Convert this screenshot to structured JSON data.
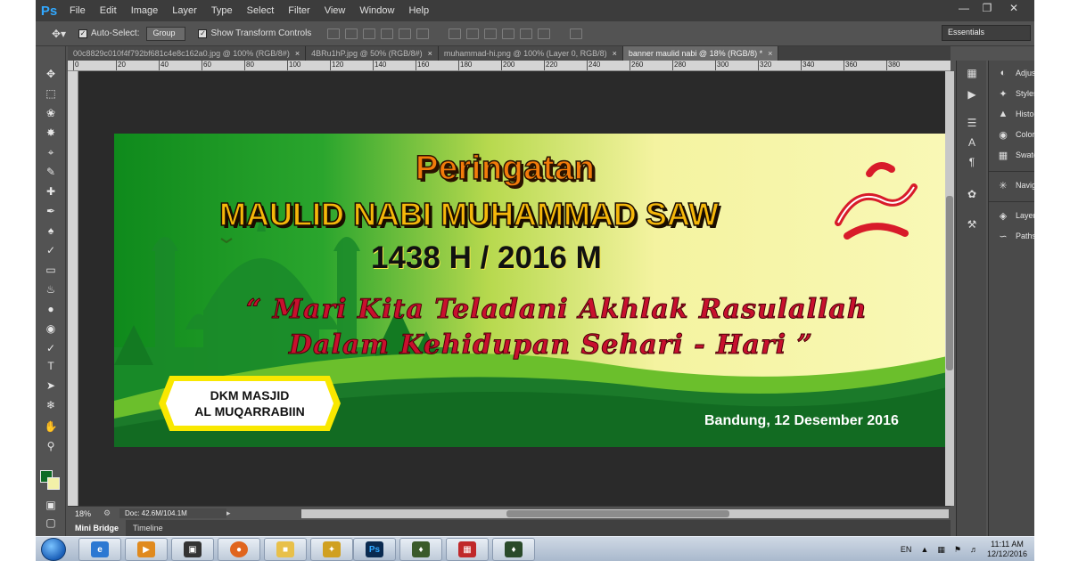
{
  "app": {
    "logo": "Ps",
    "menu": [
      "File",
      "Edit",
      "Image",
      "Layer",
      "Type",
      "Select",
      "Filter",
      "View",
      "Window",
      "Help"
    ],
    "window_buttons": [
      "minimize-icon",
      "restore-icon",
      "close-icon"
    ]
  },
  "options_bar": {
    "auto_select_label": "Auto-Select:",
    "auto_select_value": "Group",
    "show_transform_label": "Show Transform Controls",
    "workspace": "Essentials"
  },
  "tabs": [
    {
      "label": "00c8829c010f4f792bf681c4e8c162a0.jpg @ 100% (RGB/8#)",
      "active": false
    },
    {
      "label": "4BRu1hP.jpg @ 50% (RGB/8#)",
      "active": false
    },
    {
      "label": "muhammad-hi.png @ 100% (Layer 0, RGB/8)",
      "active": false
    },
    {
      "label": "banner maulid nabi @ 18% (RGB/8) *",
      "active": true
    }
  ],
  "ruler": {
    "ticks": [
      "0",
      "20",
      "40",
      "60",
      "80",
      "100",
      "120",
      "140",
      "160",
      "180",
      "200",
      "220",
      "240",
      "260",
      "280",
      "300",
      "320",
      "340",
      "360",
      "380"
    ]
  },
  "banner": {
    "title1": "Peringatan",
    "title2": "MAULID NABI MUHAMMAD SAW",
    "year": "1438 H / 2016 M",
    "quote1": "“ Mari Kita Teladani Akhlak Rasulallah",
    "quote2": "Dalam Kehidupan Sehari - Hari ”",
    "org_line1": "DKM MASJID",
    "org_line2": "AL MUQARRABIIN",
    "date": "Bandung, 12 Desember 2016",
    "colors": {
      "green": "#0f8a1c",
      "yellow": "#f9f8b6",
      "orange": "#f27b0a",
      "red": "#c8102e"
    }
  },
  "panels": [
    {
      "label": "Adjustments",
      "icon": "adjustments-icon"
    },
    {
      "label": "Styles",
      "icon": "styles-icon"
    },
    {
      "label": "Histogram",
      "icon": "histogram-icon"
    },
    {
      "label": "Color",
      "icon": "color-icon"
    },
    {
      "label": "Swatches",
      "icon": "swatches-icon"
    },
    {
      "label": "Navigator",
      "icon": "navigator-icon"
    },
    {
      "label": "Layers",
      "icon": "layers-icon"
    },
    {
      "label": "Paths",
      "icon": "paths-icon"
    }
  ],
  "status": {
    "zoom": "18%",
    "doc_size": "Doc: 42.6M/104.1M"
  },
  "bottom_tabs": [
    "Mini Bridge",
    "Timeline"
  ],
  "taskbar": {
    "language": "EN",
    "time": "11:11 AM",
    "date": "12/12/2016"
  }
}
